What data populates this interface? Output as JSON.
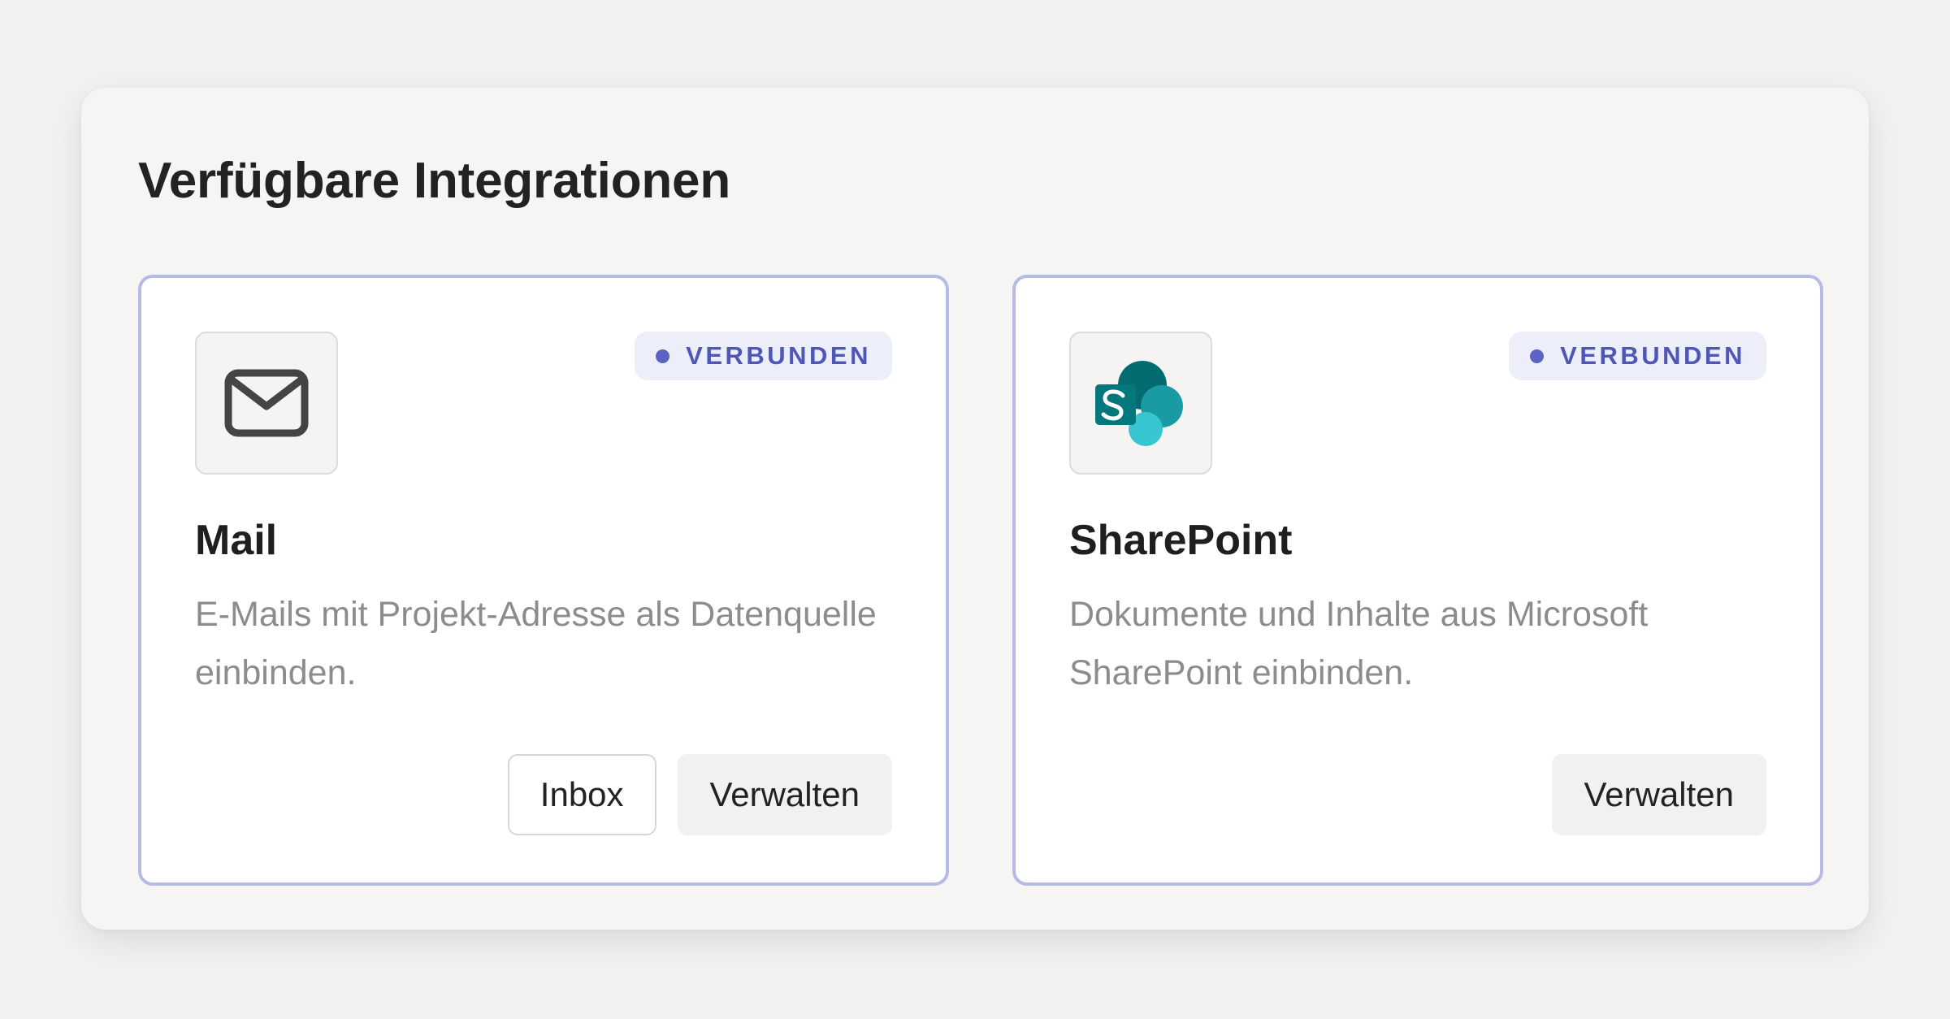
{
  "panel": {
    "title": "Verfügbare Integrationen"
  },
  "integrations": [
    {
      "name": "Mail",
      "icon": "mail-envelope-icon",
      "status": "VERBUNDEN",
      "description": "E-Mails mit Projekt-Adresse als Datenquelle einbinden.",
      "actions": [
        "Inbox",
        "Verwalten"
      ]
    },
    {
      "name": "SharePoint",
      "icon": "sharepoint-logo-icon",
      "status": "VERBUNDEN",
      "description": "Dokumente und Inhalte aus Microsoft SharePoint einbinden.",
      "actions": [
        "Verwalten"
      ]
    }
  ],
  "colors": {
    "accent": "#5c63c4",
    "card_border": "#b6bbe6",
    "badge_bg": "#eceef9",
    "sharepoint_dark": "#036c70",
    "sharepoint_mid": "#1a9ba1",
    "sharepoint_light": "#37c6d0"
  }
}
